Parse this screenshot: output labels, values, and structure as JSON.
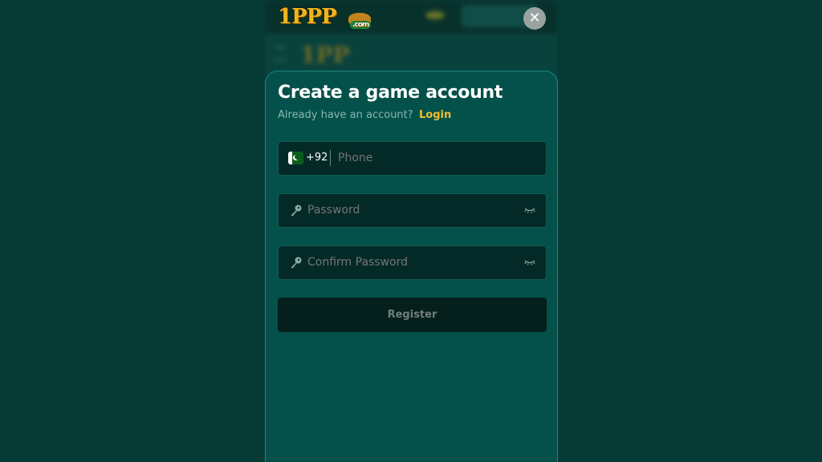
{
  "header": {
    "logo_text": "1PP",
    "logo_suffix": ".com"
  },
  "modal": {
    "title": "Create a game account",
    "subtitle": "Already have an account?",
    "login_link": "Login",
    "phone": {
      "country_code": "+92",
      "placeholder": "Phone",
      "flag": "pakistan-flag"
    },
    "password": {
      "placeholder": "Password"
    },
    "confirm_password": {
      "placeholder": "Confirm Password"
    },
    "register_label": "Register"
  },
  "icons": {
    "close": "close-icon",
    "key": "key-icon",
    "eye_closed": "eye-closed-icon"
  },
  "colors": {
    "background": "#053a35",
    "modal": "#04514b",
    "accent": "#f0c030",
    "input": "#042a27",
    "button": "#041f1c"
  }
}
